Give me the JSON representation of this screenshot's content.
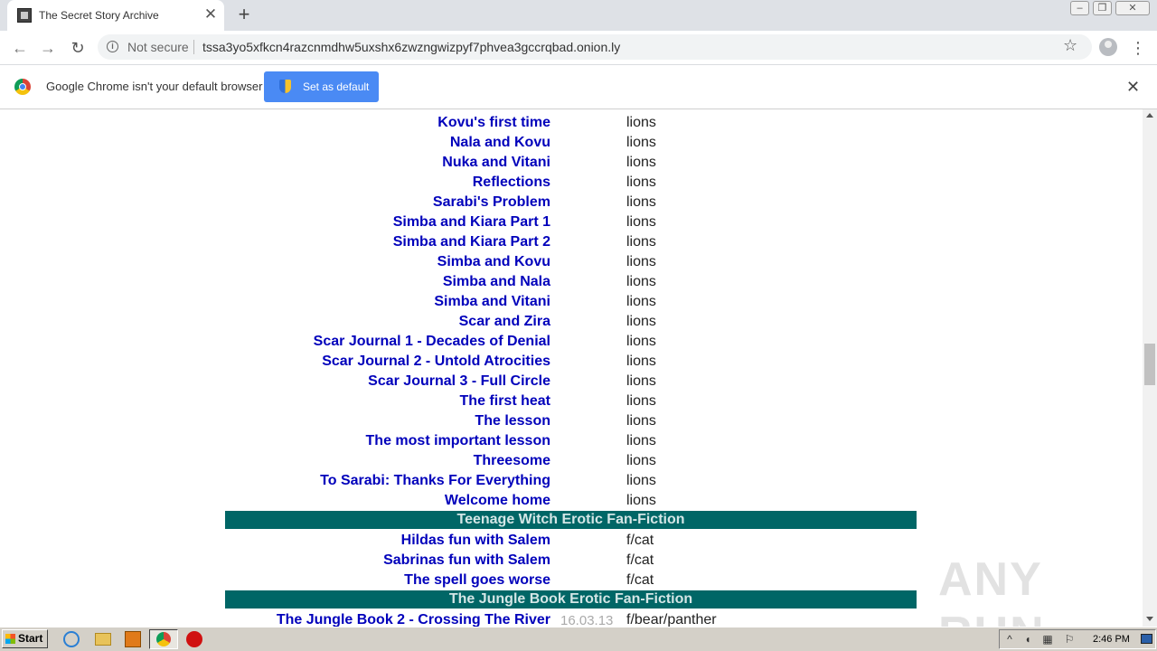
{
  "browser": {
    "tab_title": "The Secret Story Archive",
    "tab_close": "✕",
    "new_tab": "+",
    "security_label": "Not secure",
    "url": "tssa3yo5xfkcn4razcnmdhw5uxshx6zwzngwizpyf7phvea3gccrqbad.onion.ly",
    "back": "←",
    "forward": "→",
    "reload": "↻",
    "star": "☆",
    "menu": "⋮",
    "window_minimize": "–",
    "window_restore": "❐",
    "window_close": "✕"
  },
  "infobar": {
    "message": "Google Chrome isn't your default browser",
    "button_label": "Set as default",
    "close": "✕"
  },
  "stories": [
    {
      "title": "Kovu's first time",
      "category": "lions"
    },
    {
      "title": "Nala and Kovu",
      "category": "lions"
    },
    {
      "title": "Nuka and Vitani",
      "category": "lions"
    },
    {
      "title": "Reflections",
      "category": "lions"
    },
    {
      "title": "Sarabi's Problem",
      "category": "lions"
    },
    {
      "title": "Simba and Kiara Part 1",
      "category": "lions"
    },
    {
      "title": "Simba and Kiara Part 2",
      "category": "lions"
    },
    {
      "title": "Simba and Kovu",
      "category": "lions"
    },
    {
      "title": "Simba and Nala",
      "category": "lions"
    },
    {
      "title": "Simba and Vitani",
      "category": "lions"
    },
    {
      "title": "Scar and Zira",
      "category": "lions"
    },
    {
      "title": "Scar Journal 1 - Decades of Denial",
      "category": "lions"
    },
    {
      "title": "Scar Journal 2 - Untold Atrocities",
      "category": "lions"
    },
    {
      "title": "Scar Journal 3 - Full Circle",
      "category": "lions"
    },
    {
      "title": "The first heat",
      "category": "lions"
    },
    {
      "title": "The lesson",
      "category": "lions"
    },
    {
      "title": "The most important lesson",
      "category": "lions"
    },
    {
      "title": "Threesome",
      "category": "lions"
    },
    {
      "title": "To Sarabi: Thanks For Everything",
      "category": "lions"
    },
    {
      "title": "Welcome home",
      "category": "lions"
    }
  ],
  "section_witch": {
    "header": "Teenage Witch Erotic Fan-Fiction",
    "stories": [
      {
        "title": "Hildas fun with Salem",
        "category": "f/cat"
      },
      {
        "title": "Sabrinas fun with Salem",
        "category": "f/cat"
      },
      {
        "title": "The spell goes worse",
        "category": "f/cat"
      }
    ]
  },
  "section_jungle": {
    "header": "The Jungle Book Erotic Fan-Fiction",
    "stories": [
      {
        "title": "The Jungle Book 2 - Crossing The River",
        "date": "16.03.13",
        "category": "f/bear/panther"
      }
    ]
  },
  "watermark": "ANY RUN",
  "taskbar": {
    "start_label": "Start",
    "clock": "2:46 PM",
    "tray_chevron": "^"
  }
}
